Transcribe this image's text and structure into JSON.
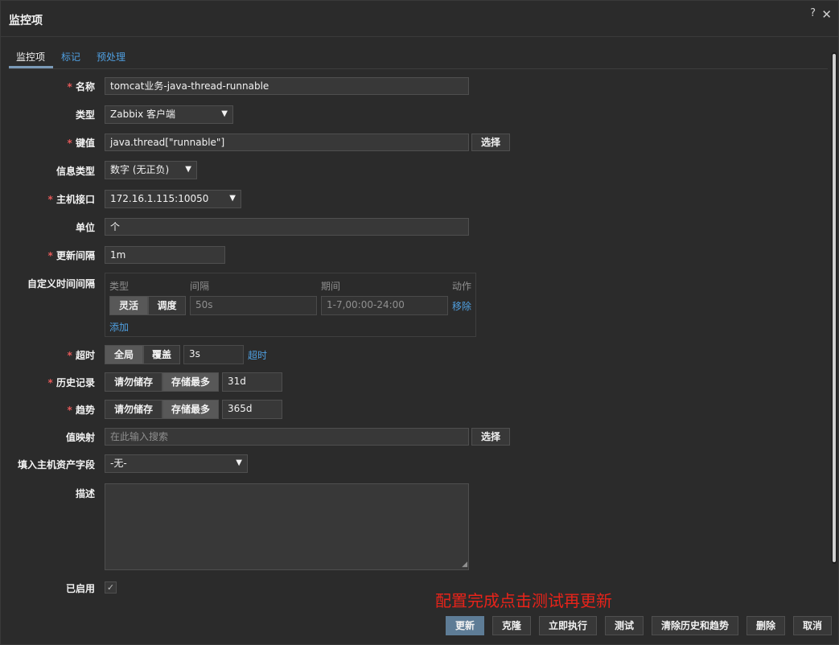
{
  "dialog": {
    "title": "监控项",
    "help": "?",
    "close": "✕"
  },
  "tabs": [
    {
      "label": "监控项"
    },
    {
      "label": "标记"
    },
    {
      "label": "预处理"
    }
  ],
  "form": {
    "name": {
      "label": "名称",
      "value": "tomcat业务-java-thread-runnable"
    },
    "type": {
      "label": "类型",
      "value": "Zabbix 客户端"
    },
    "key": {
      "label": "键值",
      "value": "java.thread[\"runnable\"]",
      "select": "选择"
    },
    "info_type": {
      "label": "信息类型",
      "value": "数字 (无正负)"
    },
    "host_interface": {
      "label": "主机接口",
      "value": "172.16.1.115:10050"
    },
    "units": {
      "label": "单位",
      "value": "个"
    },
    "update_interval": {
      "label": "更新间隔",
      "value": "1m"
    },
    "custom_intervals": {
      "label": "自定义时间间隔",
      "headers": {
        "type": "类型",
        "interval": "间隔",
        "period": "期间",
        "action": "动作"
      },
      "row": {
        "flexible": "灵活",
        "scheduling": "调度",
        "interval": "50s",
        "period": "1-7,00:00-24:00",
        "remove": "移除"
      },
      "add": "添加"
    },
    "timeout": {
      "label": "超时",
      "global": "全局",
      "override": "覆盖",
      "value": "3s",
      "link": "超时"
    },
    "history": {
      "label": "历史记录",
      "no_store": "请勿储存",
      "store_up_to": "存储最多",
      "value": "31d"
    },
    "trends": {
      "label": "趋势",
      "no_store": "请勿储存",
      "store_up_to": "存储最多",
      "value": "365d"
    },
    "value_map": {
      "label": "值映射",
      "placeholder": "在此输入搜索",
      "select": "选择"
    },
    "inventory": {
      "label": "填入主机资产字段",
      "value": "-无-"
    },
    "description": {
      "label": "描述",
      "value": ""
    },
    "enabled": {
      "label": "已启用",
      "checked": true
    }
  },
  "annotation": "配置完成点击测试再更新",
  "footer": {
    "update": "更新",
    "clone": "克隆",
    "execute_now": "立即执行",
    "test": "测试",
    "clear": "清除历史和趋势",
    "delete": "删除",
    "cancel": "取消"
  }
}
